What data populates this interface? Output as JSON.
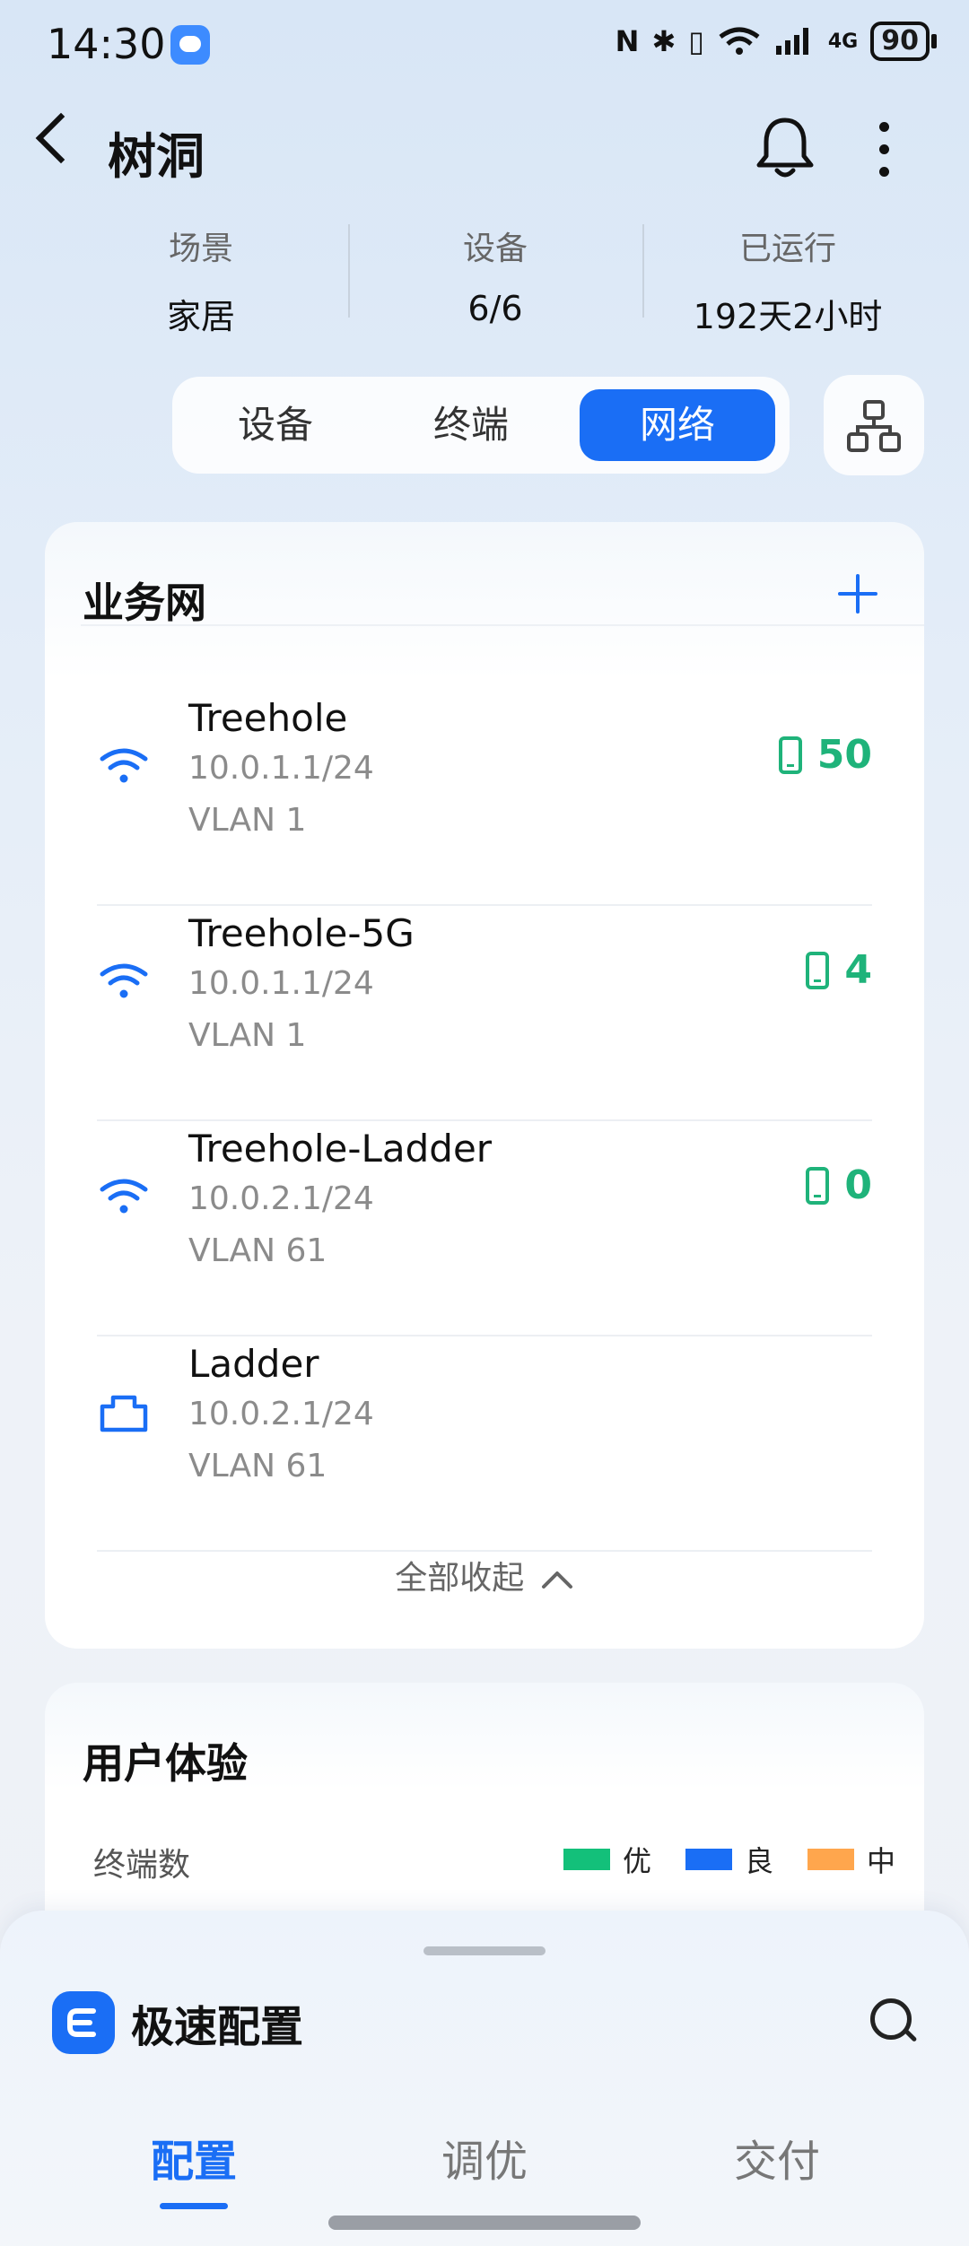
{
  "status": {
    "time": "14:30",
    "battery": "90",
    "network": "4G"
  },
  "header": {
    "title": "树洞"
  },
  "stats": [
    {
      "label": "场景",
      "value": "家居"
    },
    {
      "label": "设备",
      "value": "6/6"
    },
    {
      "label": "已运行",
      "value": "192天2小时"
    }
  ],
  "segments": [
    {
      "label": "设备"
    },
    {
      "label": "终端"
    },
    {
      "label": "网络"
    }
  ],
  "business_net": {
    "title": "业务网",
    "rows": [
      {
        "name": "Treehole",
        "ip": "10.0.1.1/24",
        "vlan": "VLAN 1",
        "count": "50",
        "type": "wifi"
      },
      {
        "name": "Treehole-5G",
        "ip": "10.0.1.1/24",
        "vlan": "VLAN 1",
        "count": "4",
        "type": "wifi"
      },
      {
        "name": "Treehole-Ladder",
        "ip": "10.0.2.1/24",
        "vlan": "VLAN 61",
        "count": "0",
        "type": "wifi"
      },
      {
        "name": "Ladder",
        "ip": "10.0.2.1/24",
        "vlan": "VLAN 61",
        "count": "",
        "type": "wired"
      }
    ],
    "collapse_label": "全部收起"
  },
  "experience": {
    "title": "用户体验",
    "metric_label": "终端数",
    "legend": [
      {
        "label": "优",
        "color": "#13c07a"
      },
      {
        "label": "良",
        "color": "#1a6ef5"
      },
      {
        "label": "中",
        "color": "#ffa64d"
      }
    ]
  },
  "sheet": {
    "app_name": "极速配置",
    "tabs": [
      {
        "label": "配置"
      },
      {
        "label": "调优"
      },
      {
        "label": "交付"
      }
    ]
  },
  "colors": {
    "accent": "#1a6ef5",
    "success": "#1fb37a"
  }
}
